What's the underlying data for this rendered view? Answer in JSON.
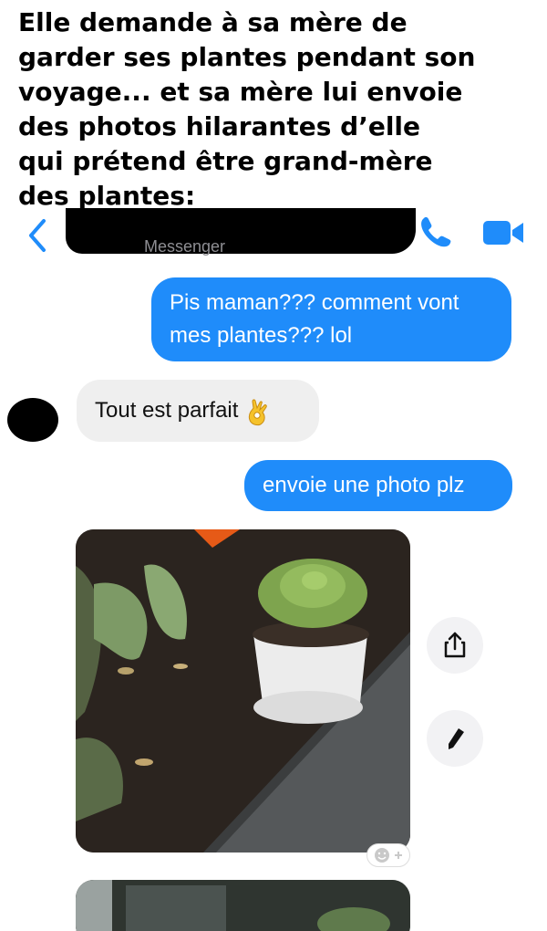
{
  "caption": {
    "lines": [
      "Elle demande à sa mère de",
      "garder ses plantes pendant son",
      "voyage... et sa mère lui envoie",
      "des photos hilarantes d’elle",
      "qui prétend être grand-mère",
      "des plantes:"
    ]
  },
  "header": {
    "app_name": "Messenger",
    "back_icon": "chevron-left-icon",
    "call_icon": "phone-icon",
    "video_icon": "video-camera-icon"
  },
  "messages": [
    {
      "direction": "outgoing",
      "lines": [
        "Pis maman??? comment vont",
        "mes plantes??? lol"
      ]
    },
    {
      "direction": "incoming",
      "text": "Tout est parfait",
      "emoji": "ok-hand-icon"
    },
    {
      "direction": "outgoing",
      "text": "envoie une photo plz"
    }
  ],
  "photo_actions": {
    "share_icon": "share-icon",
    "edit_icon": "pencil-icon",
    "reaction_icon": "add-reaction-icon"
  },
  "colors": {
    "accent": "#1f8cfa",
    "incoming_bubble": "#efefef",
    "outgoing_text": "#ffffff"
  }
}
